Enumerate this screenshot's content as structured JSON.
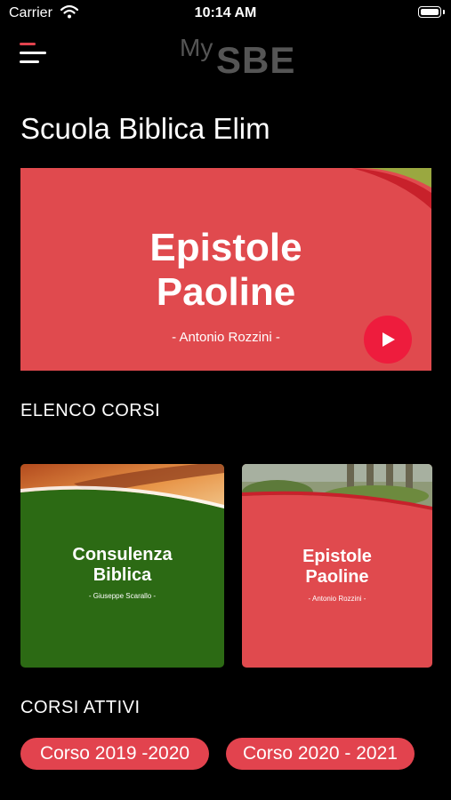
{
  "status_bar": {
    "carrier": "Carrier",
    "time": "10:14 AM"
  },
  "header": {
    "logo_my": "My",
    "logo_sbe": "SBE"
  },
  "page": {
    "title": "Scuola Biblica Elim"
  },
  "hero": {
    "title_line1": "Epistole",
    "title_line2": "Paoline",
    "author": "- Antonio Rozzini -"
  },
  "sections": {
    "courses": "ELENCO CORSI",
    "active": "CORSI ATTIVI"
  },
  "courses": [
    {
      "title_line1": "Consulenza",
      "title_line2": "Biblica",
      "author": "- Giuseppe Scarallo -"
    },
    {
      "title_line1": "Epistole",
      "title_line2": "Paoline",
      "author": "- Antonio Rozzini -"
    }
  ],
  "active_courses": [
    {
      "label": "Corso 2019 -2020"
    },
    {
      "label": "Corso 2020 - 2021"
    }
  ],
  "colors": {
    "accent": "#e2434e",
    "card_red": "#e04a4e",
    "card_green": "#2c6a14",
    "logo": "#555555",
    "play": "#ee1c3d"
  }
}
